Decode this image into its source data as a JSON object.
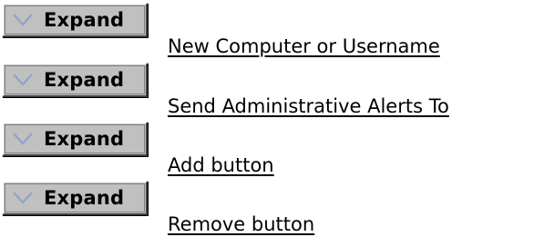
{
  "items": [
    {
      "button_label": "Expand",
      "button_icon": "chevron-down-icon",
      "link_text": "New Computer or Username"
    },
    {
      "button_label": "Expand",
      "button_icon": "chevron-down-icon",
      "link_text": "Send Administrative Alerts To"
    },
    {
      "button_label": "Expand",
      "button_icon": "chevron-down-icon",
      "link_text": "Add button"
    },
    {
      "button_label": "Expand",
      "button_icon": "chevron-down-icon",
      "link_text": "Remove button"
    }
  ],
  "colors": {
    "button_face": "#c0c0c0",
    "chevron": "#8ea4c8",
    "text": "#000000"
  }
}
